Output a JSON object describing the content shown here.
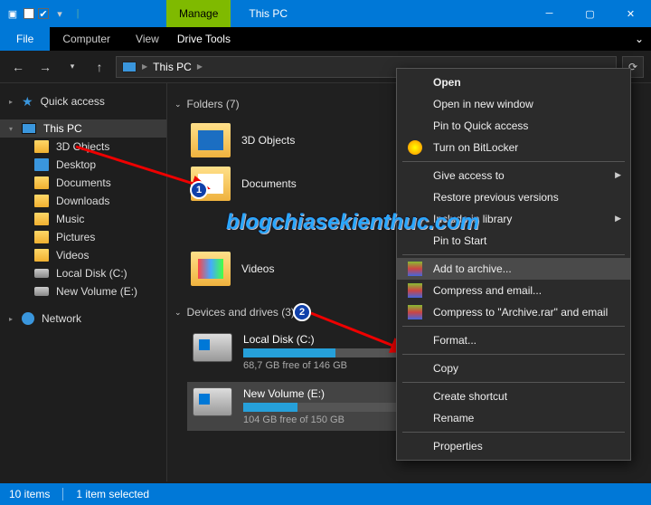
{
  "titlebar": {
    "manage": "Manage",
    "title": "This PC"
  },
  "ribbon": {
    "file": "File",
    "computer": "Computer",
    "view": "View",
    "drive_tools": "Drive Tools"
  },
  "address": {
    "location": "This PC"
  },
  "sidebar": {
    "quick": "Quick access",
    "this_pc": "This PC",
    "objects3d": "3D Objects",
    "desktop": "Desktop",
    "documents": "Documents",
    "downloads": "Downloads",
    "music": "Music",
    "pictures": "Pictures",
    "videos": "Videos",
    "localdisk": "Local Disk (C:)",
    "newvolume": "New Volume (E:)",
    "network": "Network"
  },
  "main": {
    "folders_header": "Folders (7)",
    "drives_header": "Devices and drives (3)",
    "tiles": {
      "objects3d": "3D Objects",
      "documents": "Documents",
      "videos": "Videos"
    },
    "drives": [
      {
        "name": "Local Disk (C:)",
        "free": "68,7 GB free of 146 GB",
        "pct": 53
      },
      {
        "name": "New Volume (E:)",
        "free": "104 GB free of 150 GB",
        "pct": 31
      }
    ]
  },
  "context": {
    "open": "Open",
    "open_new": "Open in new window",
    "pin_quick": "Pin to Quick access",
    "bitlocker": "Turn on BitLocker",
    "give_access": "Give access to",
    "restore": "Restore previous versions",
    "include_lib": "Include in library",
    "pin_start": "Pin to Start",
    "add_archive": "Add to archive...",
    "compress_email": "Compress and email...",
    "compress_named": "Compress to \"Archive.rar\" and email",
    "format": "Format...",
    "copy": "Copy",
    "create_shortcut": "Create shortcut",
    "rename": "Rename",
    "properties": "Properties"
  },
  "status": {
    "items": "10 items",
    "selected": "1 item selected"
  },
  "overlay": {
    "watermark": "blogchiasekienthuc.com",
    "badge1": "1",
    "badge2": "2"
  }
}
